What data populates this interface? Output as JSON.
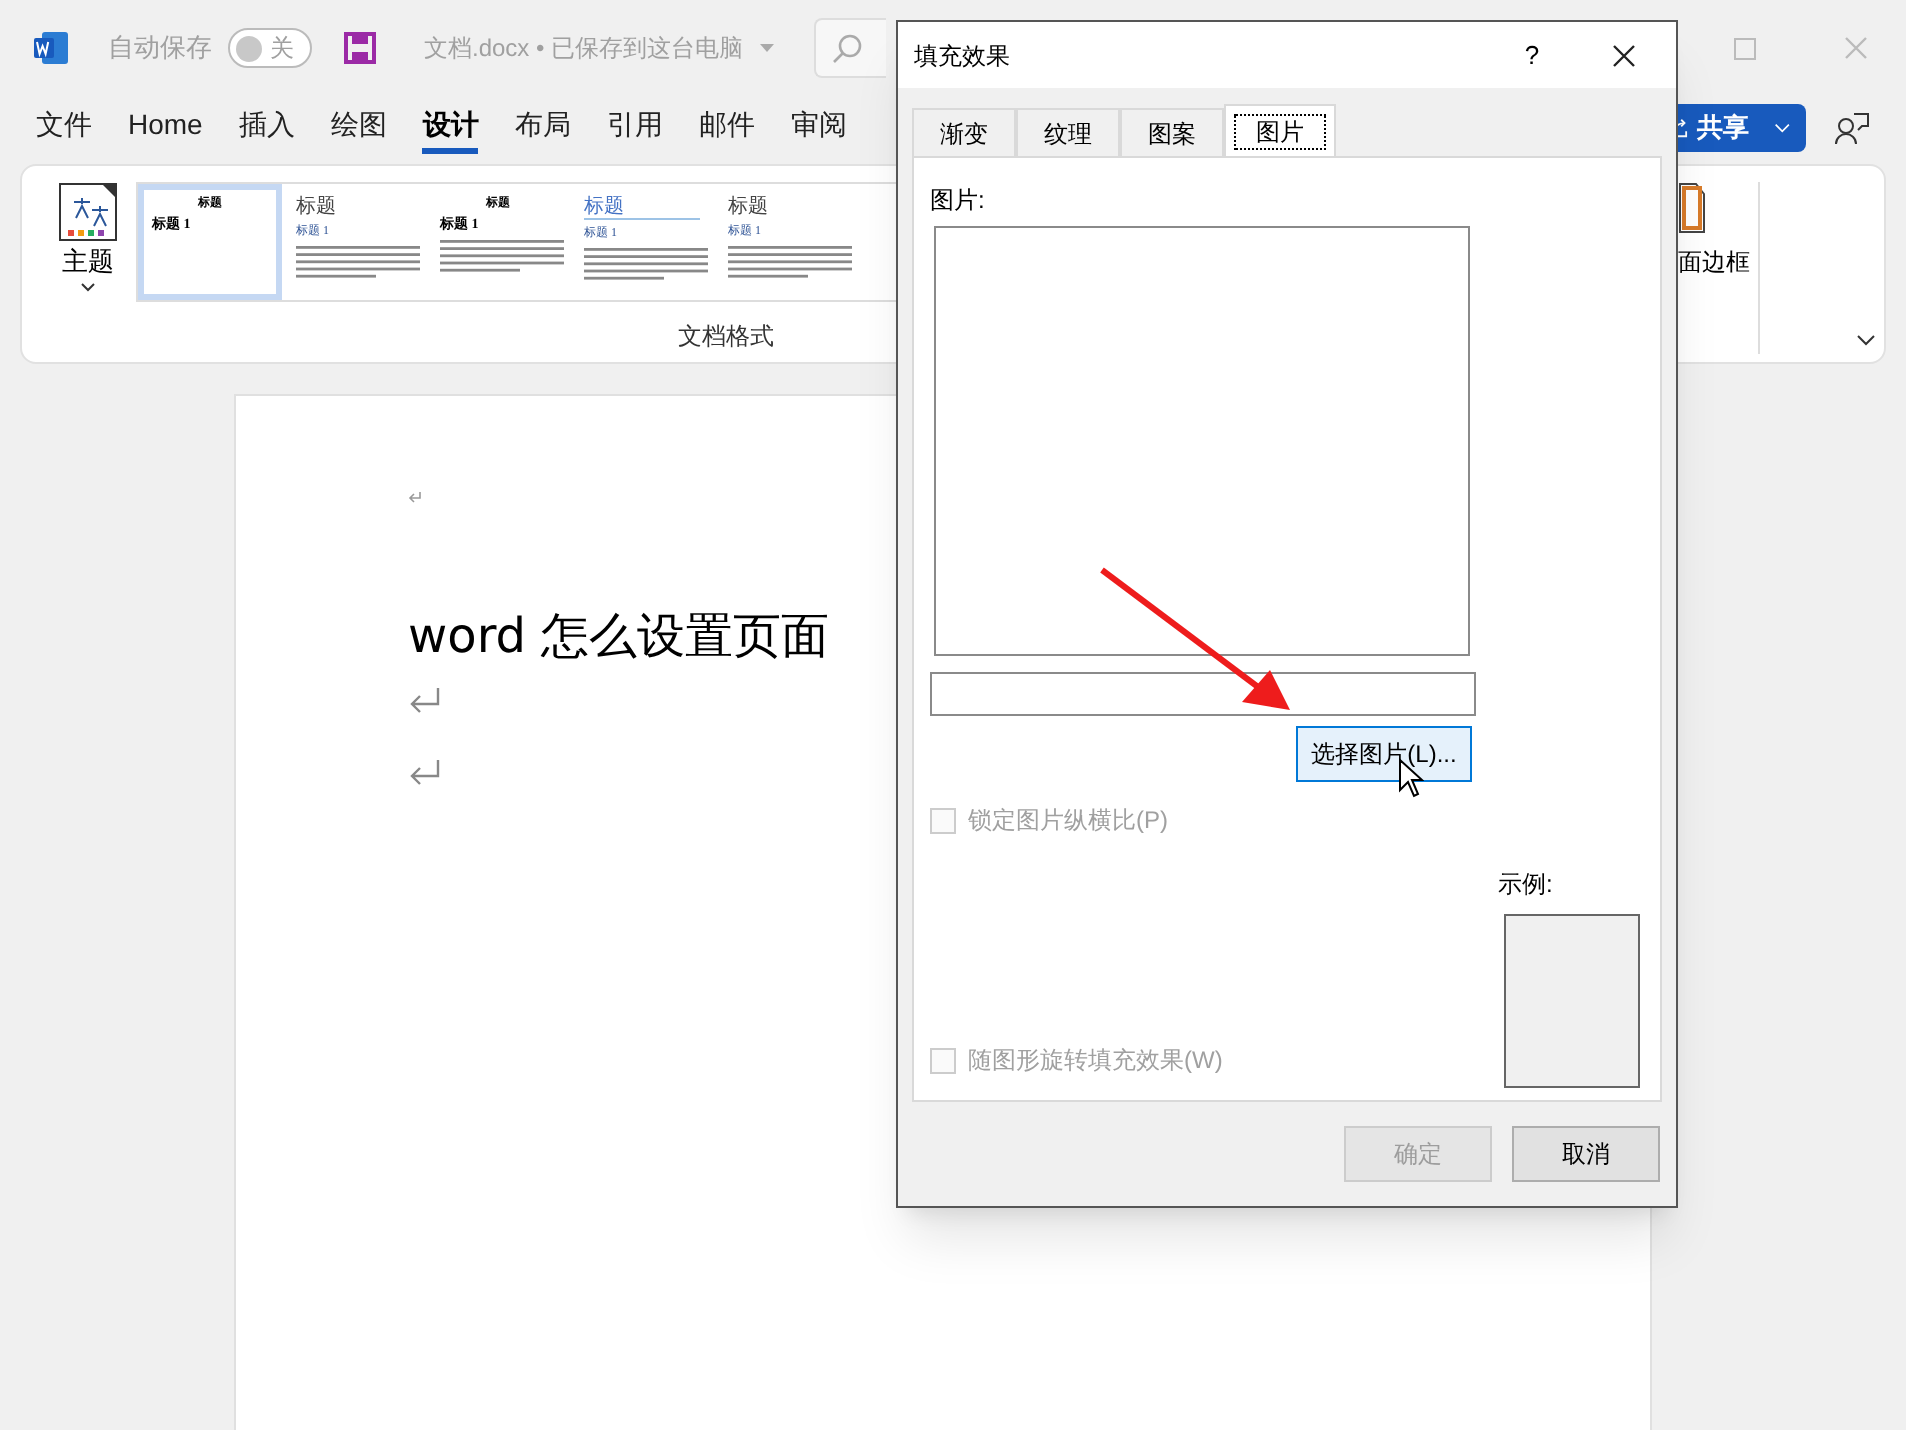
{
  "titlebar": {
    "autosave_label": "自动保存",
    "autosave_toggle": {
      "label": "关",
      "on": false
    },
    "doc_title": "文档.docx • 已保存到这台电脑"
  },
  "menu": [
    {
      "label": "文件",
      "selected": false
    },
    {
      "label": "Home",
      "selected": false
    },
    {
      "label": "插入",
      "selected": false
    },
    {
      "label": "绘图",
      "selected": false
    },
    {
      "label": "设计",
      "selected": true
    },
    {
      "label": "布局",
      "selected": false
    },
    {
      "label": "引用",
      "selected": false
    },
    {
      "label": "邮件",
      "selected": false
    },
    {
      "label": "审阅",
      "selected": false
    }
  ],
  "share_button": "共享",
  "ribbon": {
    "theme_button": "主题",
    "styles": [
      {
        "title": "标题",
        "heading": "标题 1",
        "selected": true,
        "kind": "centered"
      },
      {
        "title": "标题",
        "heading": "标题 1",
        "selected": false,
        "kind": "left"
      },
      {
        "title": "标题",
        "heading": "标题 1",
        "selected": false,
        "kind": "centered"
      },
      {
        "title": "标题",
        "heading": "标题 1",
        "selected": false,
        "kind": "underlined"
      },
      {
        "title": "标题",
        "heading": "标题 1",
        "selected": false,
        "kind": "left"
      }
    ],
    "group_label": "文档格式",
    "page_border_button": "面边框"
  },
  "document": {
    "paragraphs": [
      {
        "kind": "mark"
      },
      {
        "kind": "heading",
        "text": "word 怎么设置页面"
      },
      {
        "kind": "empty"
      },
      {
        "kind": "empty"
      }
    ]
  },
  "dialog": {
    "title": "填充效果",
    "help": "?",
    "tabs": [
      {
        "label": "渐变",
        "selected": false
      },
      {
        "label": "纹理",
        "selected": false
      },
      {
        "label": "图案",
        "selected": false
      },
      {
        "label": "图片",
        "selected": true
      }
    ],
    "picture_label": "图片:",
    "select_button": "选择图片(L)...",
    "lock_ratio": {
      "label": "锁定图片纵横比(P)",
      "checked": false,
      "disabled": true
    },
    "sample_label": "示例:",
    "rotate_fill": {
      "label": "随图形旋转填充效果(W)",
      "checked": false,
      "disabled": true
    },
    "ok_button": {
      "label": "确定",
      "disabled": true
    },
    "cancel_button": {
      "label": "取消",
      "disabled": false
    }
  }
}
